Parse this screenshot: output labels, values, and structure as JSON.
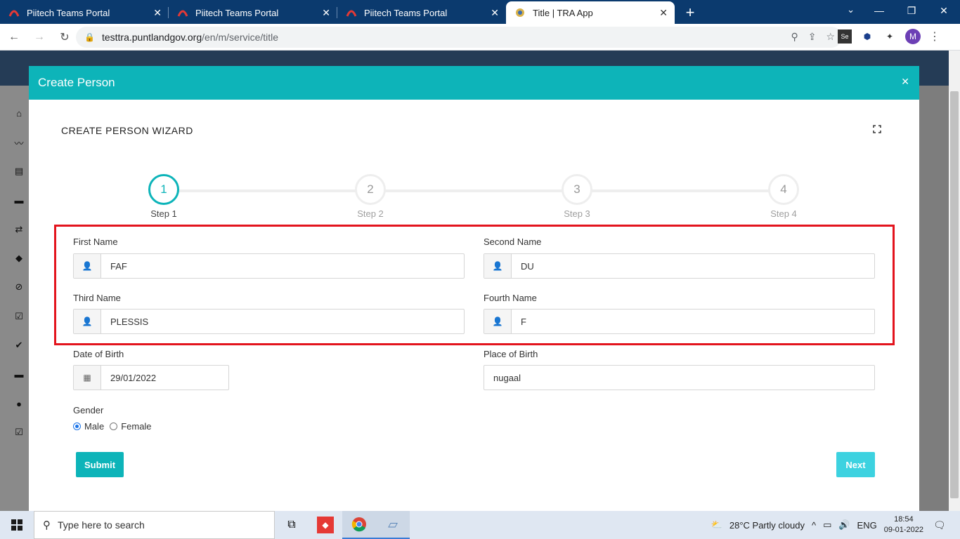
{
  "browser": {
    "tabs": [
      {
        "title": "Piitech Teams Portal",
        "active": false
      },
      {
        "title": "Piitech Teams Portal",
        "active": false
      },
      {
        "title": "Piitech Teams Portal",
        "active": false
      },
      {
        "title": "Title | TRA App",
        "active": true
      }
    ],
    "url_host": "testtra.puntlandgov.org",
    "url_path": "/en/m/service/title",
    "profile_initial": "M"
  },
  "modal": {
    "title": "Create Person",
    "wizard_title": "CREATE PERSON WIZARD",
    "steps": [
      {
        "number": "1",
        "label": "Step 1"
      },
      {
        "number": "2",
        "label": "Step 2"
      },
      {
        "number": "3",
        "label": "Step 3"
      },
      {
        "number": "4",
        "label": "Step 4"
      }
    ],
    "active_step": 1,
    "fields": {
      "first_name": {
        "label": "First Name",
        "value": "FAF"
      },
      "second_name": {
        "label": "Second Name",
        "value": "DU"
      },
      "third_name": {
        "label": "Third Name",
        "value": "PLESSIS"
      },
      "fourth_name": {
        "label": "Fourth Name",
        "value": "F"
      },
      "date_of_birth": {
        "label": "Date of Birth",
        "value": "29/01/2022"
      },
      "place_of_birth": {
        "label": "Place of Birth",
        "value": "nugaal"
      }
    },
    "gender": {
      "label": "Gender",
      "options": [
        "Male",
        "Female"
      ],
      "selected": "Male"
    },
    "submit_label": "Submit",
    "next_label": "Next"
  },
  "taskbar": {
    "search_placeholder": "Type here to search",
    "weather": "28°C  Partly cloudy",
    "language": "ENG",
    "time": "18:54",
    "date": "09-01-2022"
  },
  "colors": {
    "accent": "#0db4b9",
    "highlight_border": "#e3141d",
    "next_button": "#3dd2e0"
  }
}
